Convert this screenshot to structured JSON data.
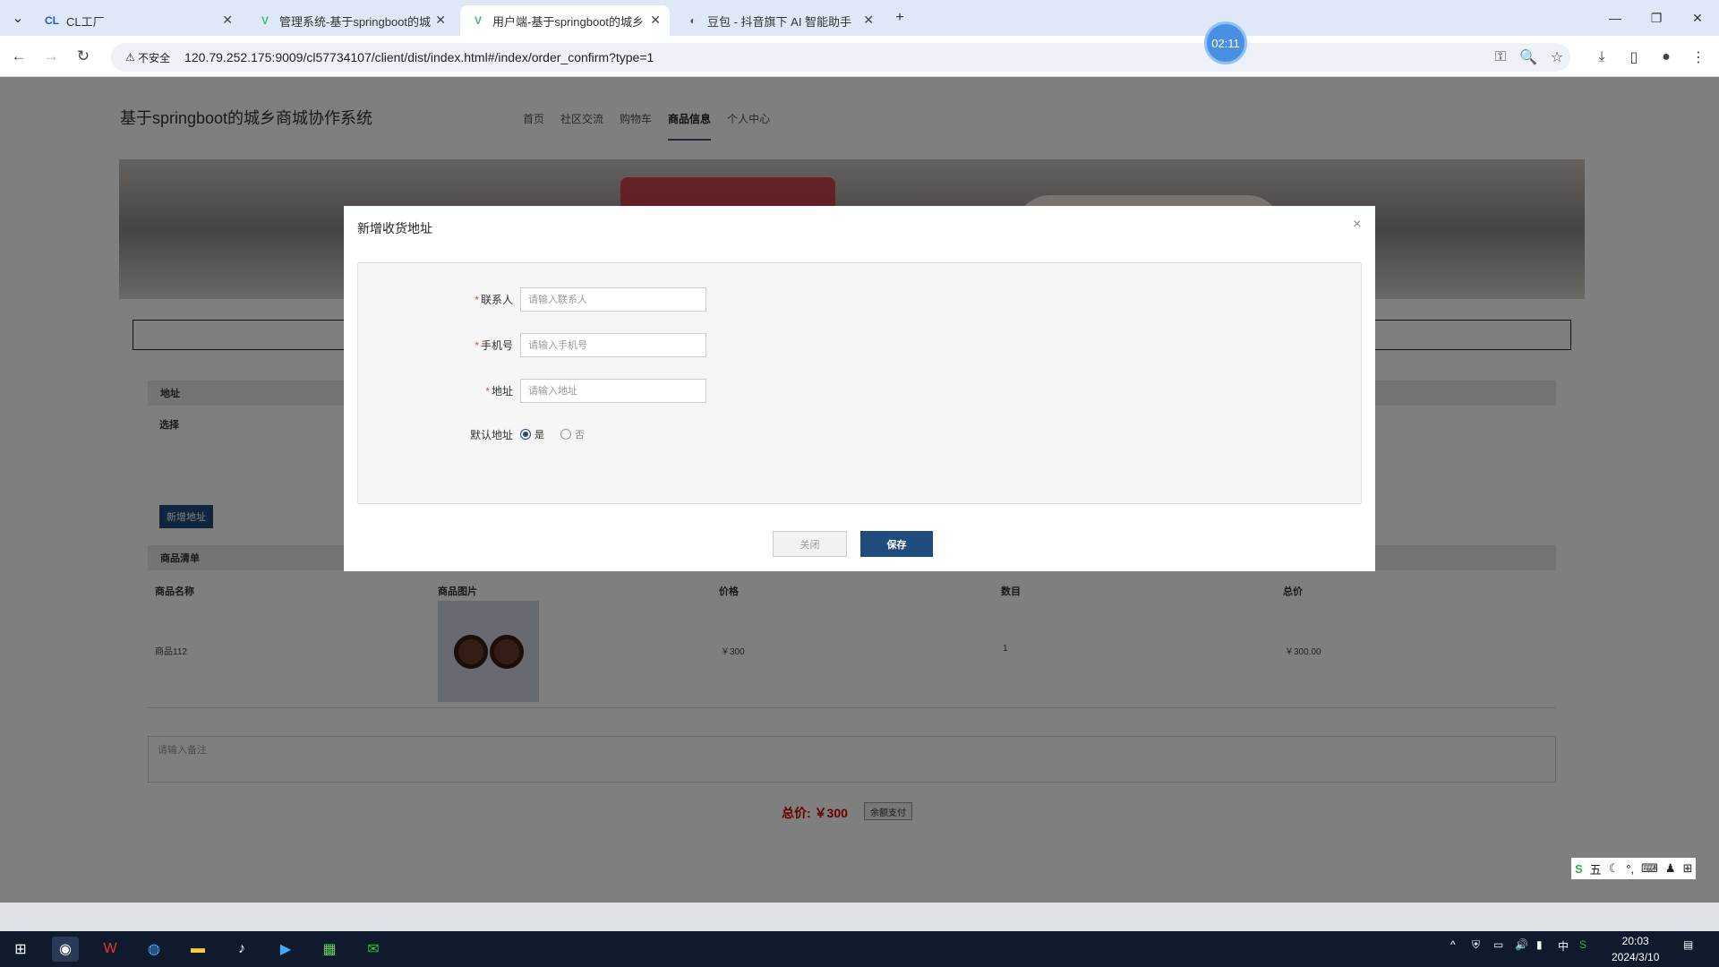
{
  "browser": {
    "tabs": [
      {
        "label": "CL工厂",
        "icon": "cl-icon"
      },
      {
        "label": "管理系统-基于springboot的城",
        "icon": "vue-icon"
      },
      {
        "label": "用户端-基于springboot的城乡",
        "icon": "vue-icon"
      },
      {
        "label": "豆包 - 抖音旗下 AI 智能助手",
        "icon": "doubao-icon"
      }
    ],
    "security_label": "不安全",
    "url": "120.79.252.175:9009/cl57734107/client/dist/index.html#/index/order_confirm?type=1",
    "timer": "02:11"
  },
  "site": {
    "title": "基于springboot的城乡商城协作系统",
    "menu": [
      "首页",
      "社区交流",
      "购物车",
      "商品信息",
      "个人中心"
    ],
    "active_menu": "商品信息"
  },
  "order": {
    "address_header": "地址",
    "select_label": "选择",
    "add_address_button": "新增地址",
    "goods_list_header": "商品清单",
    "columns": [
      "商品名称",
      "商品图片",
      "价格",
      "数目",
      "总价"
    ],
    "items": [
      {
        "name": "商品112",
        "price": "￥300",
        "qty": "1",
        "total": "￥300.00"
      }
    ],
    "remark_placeholder": "请输入备注",
    "total_label": "总价: ￥300",
    "pay_button": "余额支付"
  },
  "dialog": {
    "title": "新增收货地址",
    "fields": {
      "contact": {
        "label": "联系人",
        "placeholder": "请输入联系人"
      },
      "phone": {
        "label": "手机号",
        "placeholder": "请输入手机号"
      },
      "address": {
        "label": "地址",
        "placeholder": "请输入地址"
      }
    },
    "default_label": "默认地址",
    "default_options": [
      "是",
      "否"
    ],
    "cancel_button": "关闭",
    "save_button": "保存"
  },
  "taskbar": {
    "time": "20:03",
    "date": "2024/3/10",
    "ime_lang": "中"
  }
}
